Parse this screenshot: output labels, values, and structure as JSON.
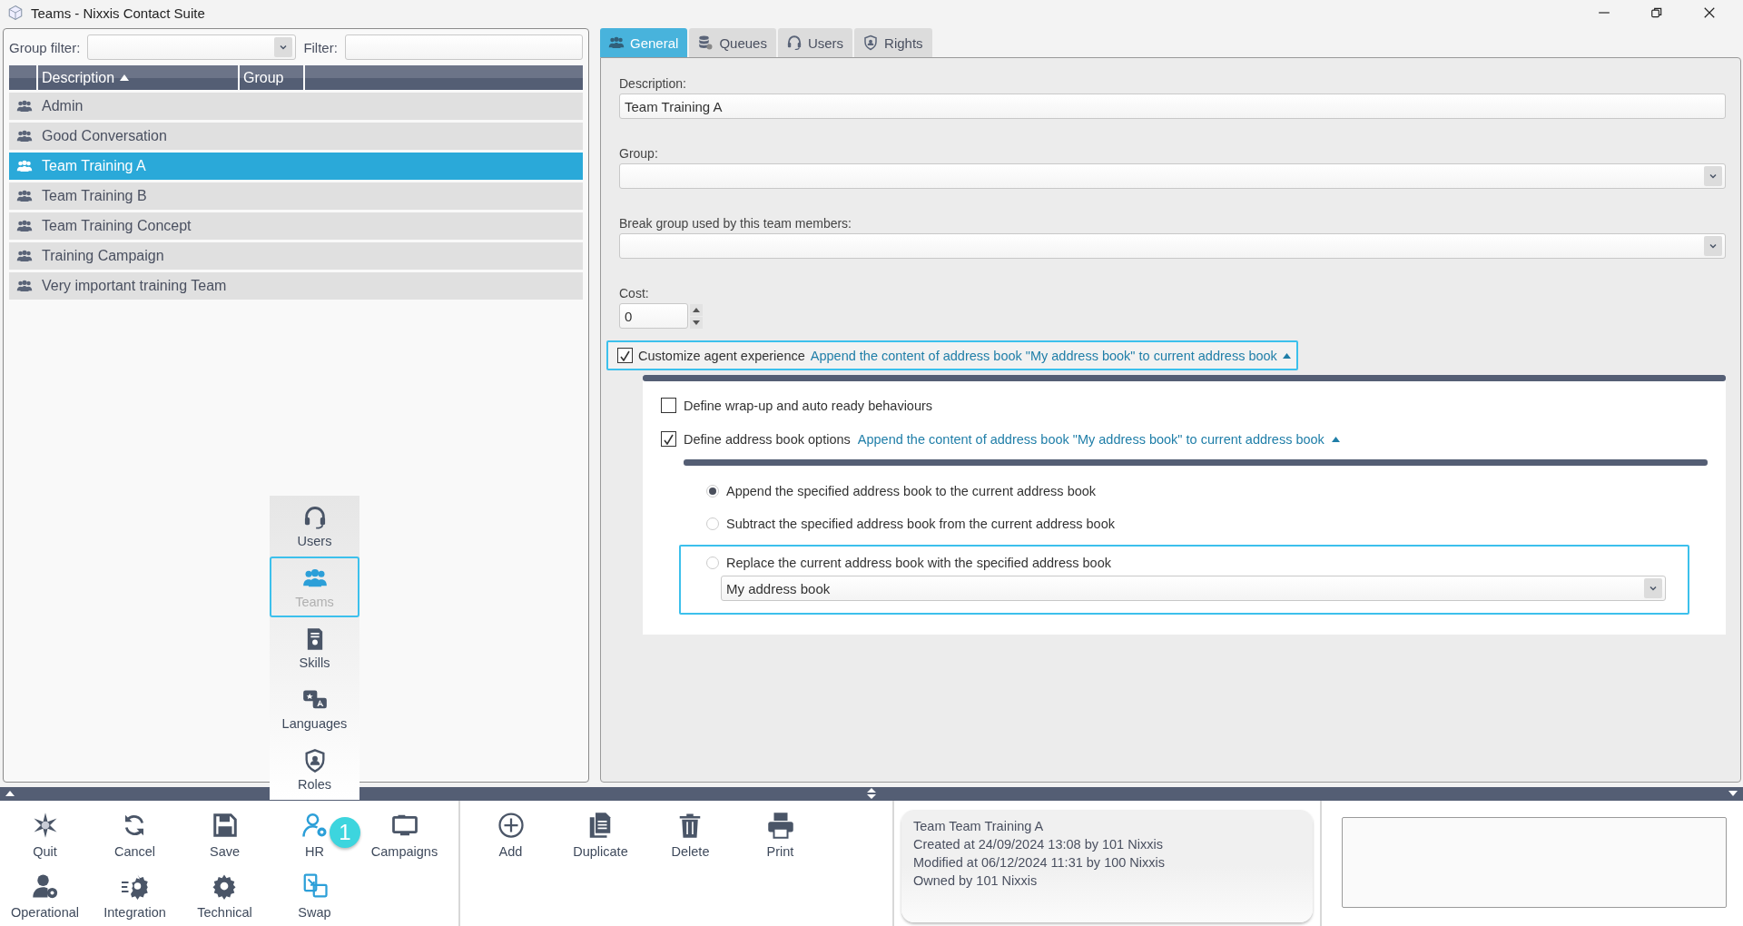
{
  "window": {
    "title": "Teams - Nixxis Contact Suite"
  },
  "list_panel": {
    "group_filter_label": "Group filter:",
    "filter_label": "Filter:",
    "columns": [
      {
        "label": "Description",
        "sorted": true
      },
      {
        "label": "Group",
        "sorted": false
      }
    ],
    "rows": [
      {
        "label": "Admin",
        "selected": false
      },
      {
        "label": "Good Conversation",
        "selected": false
      },
      {
        "label": "Team Training A",
        "selected": true
      },
      {
        "label": "Team Training B",
        "selected": false
      },
      {
        "label": "Team Training Concept",
        "selected": false
      },
      {
        "label": "Training Campaign",
        "selected": false
      },
      {
        "label": "Very important training Team",
        "selected": false
      }
    ]
  },
  "tabs": [
    {
      "label": "General",
      "selected": true
    },
    {
      "label": "Queues",
      "selected": false
    },
    {
      "label": "Users",
      "selected": false
    },
    {
      "label": "Rights",
      "selected": false
    }
  ],
  "form": {
    "description_label": "Description:",
    "description_value": "Team Training A",
    "group_label": "Group:",
    "break_group_label": "Break group used by this team members:",
    "cost_label": "Cost:",
    "cost_value": "0"
  },
  "customize": {
    "label": "Customize agent experience",
    "checked": true,
    "summary": "Append the content of address book \"My address book\" to current address book",
    "expanded": true,
    "options": [
      {
        "label": "Define wrap-up and auto ready behaviours",
        "checked": false
      },
      {
        "label": "Define address book options",
        "checked": true,
        "summary": "Append the content of address book \"My address book\" to current address book",
        "expanded": true
      }
    ]
  },
  "address_book": {
    "choices": [
      {
        "label": "Append the specified address book to the current address book",
        "selected": true,
        "focused": false
      },
      {
        "label": "Subtract the specified address book from the current address book",
        "selected": false,
        "focused": false
      },
      {
        "label": "Replace the current address book with the specified address book",
        "selected": false,
        "focused": true,
        "book": "My address book"
      }
    ]
  },
  "popup_menu": [
    {
      "label": "Users",
      "selected": false
    },
    {
      "label": "Teams",
      "selected": true
    },
    {
      "label": "Skills",
      "selected": false
    },
    {
      "label": "Languages",
      "selected": false
    },
    {
      "label": "Roles",
      "selected": false
    }
  ],
  "toolbar": {
    "actions": [
      {
        "label": "Quit"
      },
      {
        "label": "Cancel"
      },
      {
        "label": "Save"
      },
      {
        "label": "HR",
        "badge": "1"
      },
      {
        "label": "Campaigns"
      },
      {
        "label": "Operational"
      },
      {
        "label": "Integration"
      },
      {
        "label": "Technical"
      },
      {
        "label": "Swap"
      }
    ],
    "edit_actions": [
      {
        "label": "Add"
      },
      {
        "label": "Duplicate"
      },
      {
        "label": "Delete"
      },
      {
        "label": "Print"
      }
    ]
  },
  "info": {
    "lines": [
      "Team Team Training A",
      "Created at 24/09/2024 13:08 by 101 Nixxis",
      "Modified at 06/12/2024 11:31 by 100 Nixxis",
      "Owned by 101 Nixxis"
    ]
  }
}
